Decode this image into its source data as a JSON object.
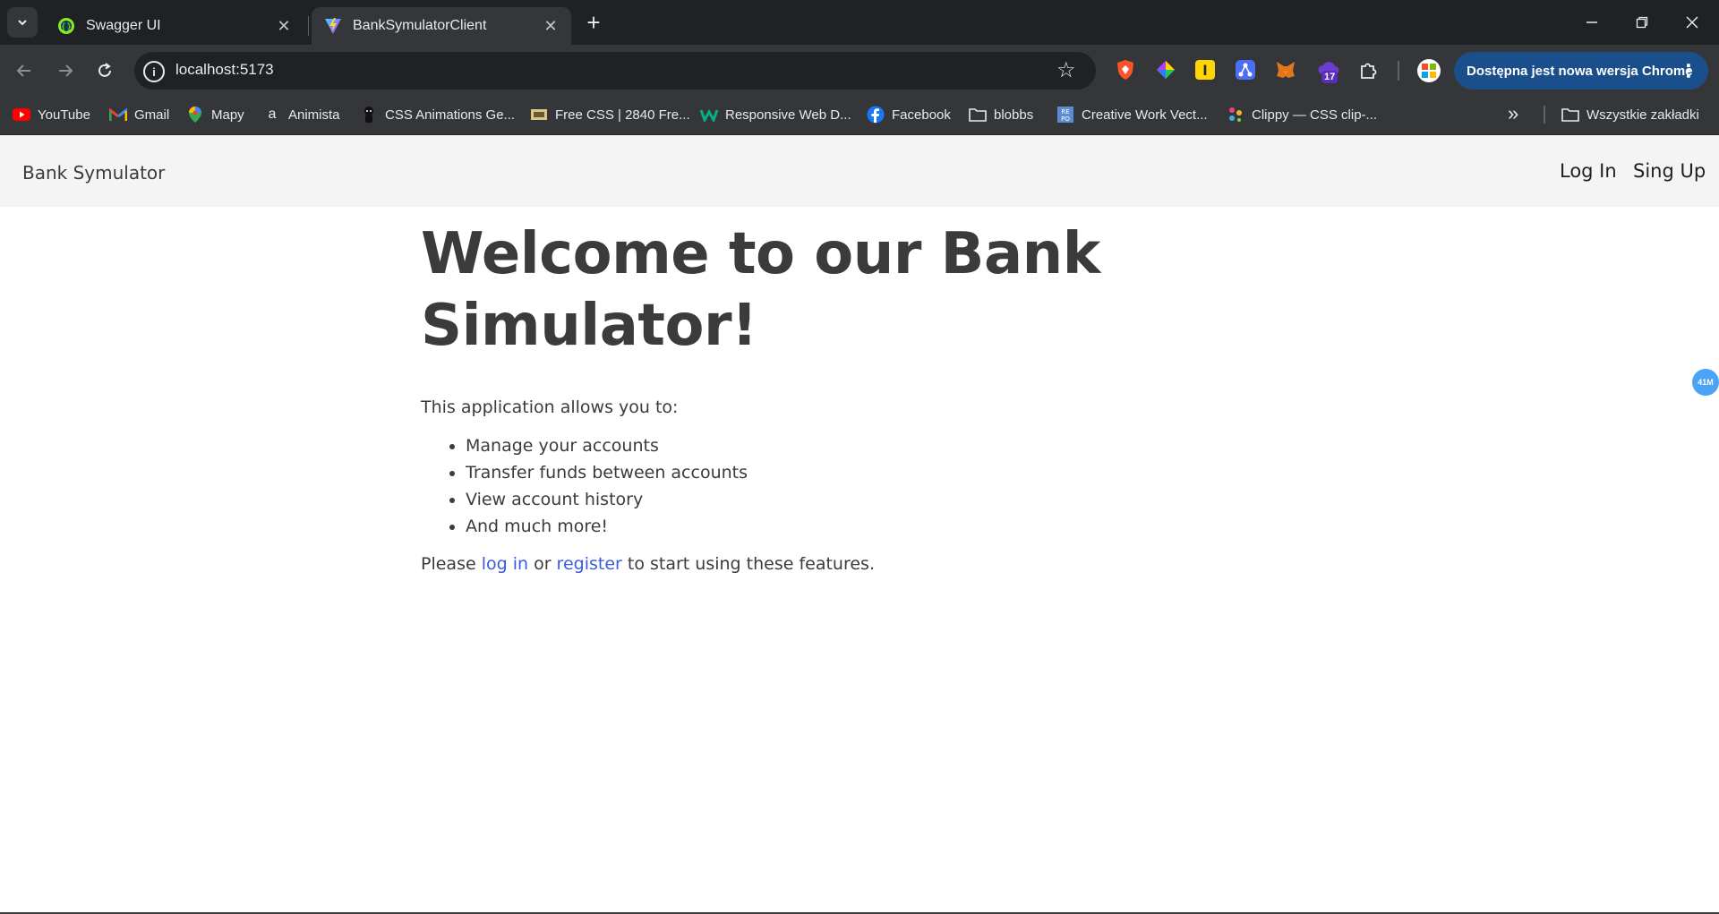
{
  "tabs": [
    {
      "title": "Swagger UI",
      "active": false
    },
    {
      "title": "BankSymulatorClient",
      "active": true
    }
  ],
  "address_bar": {
    "url": "localhost:5173"
  },
  "update_button": {
    "label": "Dostępna jest nowa wersja Chrome"
  },
  "extension_badge": "17",
  "bookmarks": [
    {
      "label": "YouTube",
      "icon": "youtube-icon"
    },
    {
      "label": "Gmail",
      "icon": "gmail-icon"
    },
    {
      "label": "Mapy",
      "icon": "maps-icon"
    },
    {
      "label": "Animista",
      "icon": "animista-icon"
    },
    {
      "label": "CSS Animations Ge...",
      "icon": "css-animations-icon"
    },
    {
      "label": "Free CSS | 2840 Fre...",
      "icon": "free-css-icon"
    },
    {
      "label": "Responsive Web D...",
      "icon": "responsive-web-icon"
    },
    {
      "label": "Facebook",
      "icon": "facebook-icon"
    },
    {
      "label": "blobbs",
      "icon": "folder-icon"
    },
    {
      "label": "Creative Work Vect...",
      "icon": "repo-icon"
    },
    {
      "label": "Clippy — CSS clip-...",
      "icon": "clippy-icon"
    }
  ],
  "all_bookmarks": "Wszystkie zakładki",
  "app": {
    "brand": "Bank Symulator",
    "nav": {
      "login": "Log In",
      "signup": "Sing Up"
    },
    "heading": "Welcome to our Bank Simulator!",
    "intro": "This application allows you to:",
    "features": [
      "Manage your accounts",
      "Transfer funds between accounts",
      "View account history",
      "And much more!"
    ],
    "cta": {
      "before": "Please ",
      "login_link": "log in",
      "middle": " or ",
      "register_link": "register",
      "after": " to start using these features."
    }
  },
  "floating_badge": "41M",
  "colors": {
    "chrome_dark": "#202124",
    "chrome_toolbar": "#35363a",
    "app_nav_bg": "#f4f4f4",
    "text": "#3b3b3b",
    "link": "#3b5bdb",
    "update_button": "#1a4f8b"
  }
}
